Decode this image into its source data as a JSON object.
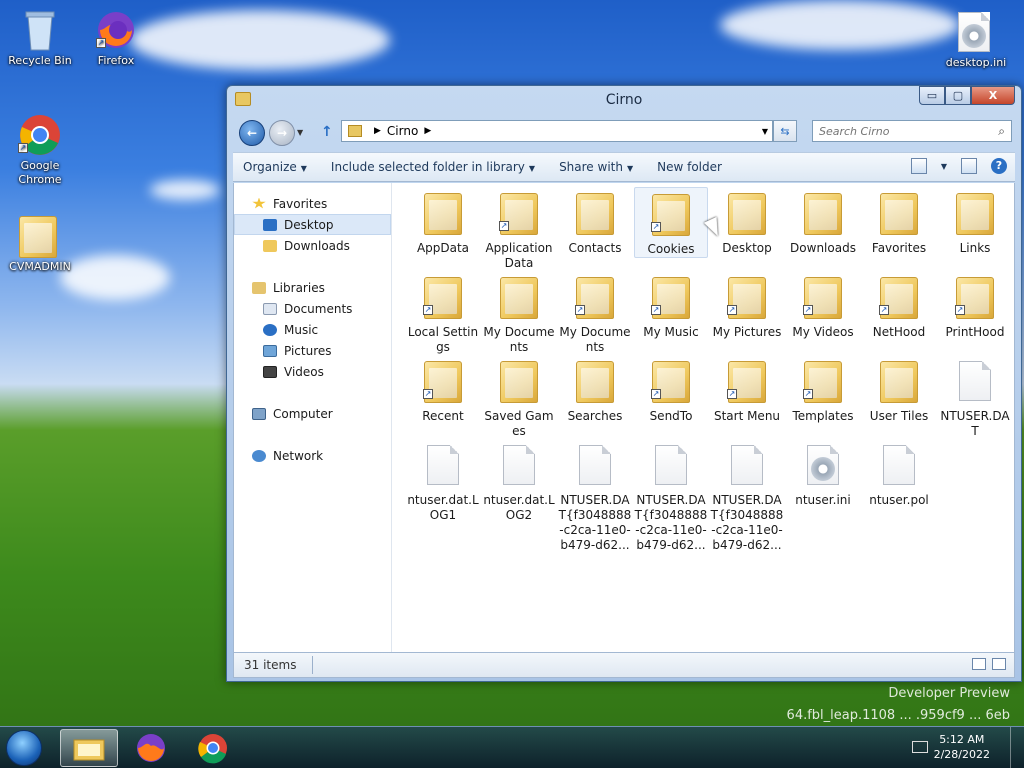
{
  "desktop": {
    "icons": [
      {
        "label": "Recycle Bin"
      },
      {
        "label": "Firefox"
      },
      {
        "label": "Google Chrome"
      },
      {
        "label": "CVMADMIN"
      },
      {
        "label": "desktop.ini"
      }
    ],
    "watermark_line1": "Developer Preview",
    "watermark_line2": "64.fbl_leap.1108 ... .959cf9 ... 6eb"
  },
  "window": {
    "title": "Cirno",
    "min_label": "▭",
    "max_label": "▢",
    "close_label": "X",
    "address": {
      "segments": [
        "Cirno"
      ]
    },
    "search": {
      "placeholder": "Search Cirno"
    },
    "toolbar": {
      "organize": "Organize",
      "include_library": "Include selected folder in library",
      "share_with": "Share with",
      "new_folder": "New folder"
    },
    "nav": {
      "favorites": "Favorites",
      "desktop": "Desktop",
      "downloads": "Downloads",
      "libraries": "Libraries",
      "documents": "Documents",
      "music": "Music",
      "pictures": "Pictures",
      "videos": "Videos",
      "computer": "Computer",
      "network": "Network"
    },
    "files": [
      {
        "name": "AppData",
        "kind": "folder"
      },
      {
        "name": "Application Data",
        "kind": "folder-shortcut"
      },
      {
        "name": "Contacts",
        "kind": "folder"
      },
      {
        "name": "Cookies",
        "kind": "folder-shortcut"
      },
      {
        "name": "Desktop",
        "kind": "folder"
      },
      {
        "name": "Downloads",
        "kind": "folder"
      },
      {
        "name": "Favorites",
        "kind": "folder"
      },
      {
        "name": "Links",
        "kind": "folder"
      },
      {
        "name": "Local Settings",
        "kind": "folder-shortcut"
      },
      {
        "name": "My Documents",
        "kind": "folder"
      },
      {
        "name": "My Documents",
        "kind": "folder-shortcut"
      },
      {
        "name": "My Music",
        "kind": "folder-shortcut"
      },
      {
        "name": "My Pictures",
        "kind": "folder-shortcut"
      },
      {
        "name": "My Videos",
        "kind": "folder-shortcut"
      },
      {
        "name": "NetHood",
        "kind": "folder-shortcut"
      },
      {
        "name": "PrintHood",
        "kind": "folder-shortcut"
      },
      {
        "name": "Recent",
        "kind": "folder-shortcut"
      },
      {
        "name": "Saved Games",
        "kind": "folder"
      },
      {
        "name": "Searches",
        "kind": "folder"
      },
      {
        "name": "SendTo",
        "kind": "folder-shortcut"
      },
      {
        "name": "Start Menu",
        "kind": "folder-shortcut"
      },
      {
        "name": "Templates",
        "kind": "folder-shortcut"
      },
      {
        "name": "User Tiles",
        "kind": "folder"
      },
      {
        "name": "NTUSER.DAT",
        "kind": "file"
      },
      {
        "name": "ntuser.dat.LOG1",
        "kind": "file"
      },
      {
        "name": "ntuser.dat.LOG2",
        "kind": "file"
      },
      {
        "name": "NTUSER.DAT{f3048888-c2ca-11e0-b479-d62...",
        "kind": "file"
      },
      {
        "name": "NTUSER.DAT{f3048888-c2ca-11e0-b479-d62...",
        "kind": "file"
      },
      {
        "name": "NTUSER.DAT{f3048888-c2ca-11e0-b479-d62...",
        "kind": "file"
      },
      {
        "name": "ntuser.ini",
        "kind": "settings-file"
      },
      {
        "name": "ntuser.pol",
        "kind": "file"
      }
    ],
    "status": {
      "item_count": "31 items"
    }
  },
  "taskbar": {
    "time": "5:12 AM",
    "date": "2/28/2022"
  },
  "colors": {
    "accent": "#1f5aa8",
    "folder": "#efc85c"
  }
}
